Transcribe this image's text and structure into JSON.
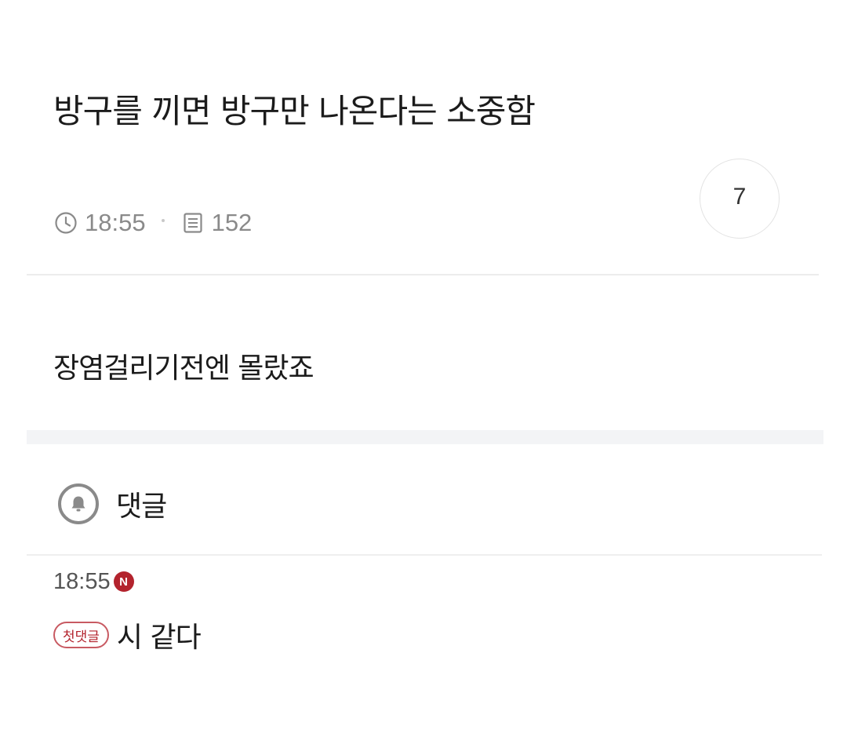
{
  "post": {
    "title": "방구를 끼면 방구만 나온다는 소중함",
    "time": "18:55",
    "views": "152",
    "reply_count": "7",
    "body": "장염걸리기전엔 몰랐죠"
  },
  "comments": {
    "header_label": "댓글",
    "items": [
      {
        "time": "18:55",
        "new_badge": "N",
        "tag": "첫댓글",
        "text": "시 같다"
      }
    ]
  },
  "icons": {
    "time": "clock-icon",
    "views": "document-icon",
    "notify": "bell-icon"
  },
  "colors": {
    "accent": "#b3232d",
    "muted_text": "#8a8a8a",
    "divider": "#ececec"
  }
}
